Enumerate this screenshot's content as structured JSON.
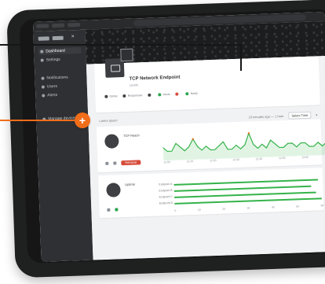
{
  "sidebar": {
    "close_glyph": "×",
    "sections": [
      {
        "title": "",
        "items": [
          {
            "label": "Dashboard",
            "active": true
          },
          {
            "label": "Settings",
            "active": false
          }
        ]
      },
      {
        "title": "",
        "items": [
          {
            "label": "Notifications",
            "active": false
          },
          {
            "label": "Users",
            "active": false
          },
          {
            "label": "Alerts",
            "active": false
          }
        ]
      },
      {
        "title": "",
        "items": [
          {
            "label": "Manage devices",
            "active": false
          }
        ]
      }
    ]
  },
  "header": {
    "title": "TCP Network Endpoint",
    "subtitle": "Lorem"
  },
  "actions": [
    {
      "label": "Online",
      "color": "#444444"
    },
    {
      "label": "Responsive",
      "color": "#444444"
    },
    {
      "label": "",
      "color": "#444444"
    },
    {
      "label": "Alerts",
      "color": "#2ea44f"
    },
    {
      "label": "",
      "color": "#d64b3a"
    },
    {
      "label": "Notify",
      "color": "#2ea44f"
    }
  ],
  "filter": {
    "left": "Lorem ipsum",
    "range": "10 minutes ago — 1 hour",
    "select": "Select Time"
  },
  "metrics": [
    {
      "title": "TCP Reach",
      "button": "Remove",
      "x_ticks": [
        "12:00",
        "12:10",
        "12:20",
        "12:30",
        "12:40",
        "12:50",
        "13:00",
        "13:10"
      ],
      "chart_points": [
        3,
        2,
        2,
        4,
        3,
        2,
        3,
        5,
        3,
        2,
        3,
        2,
        2,
        3,
        4,
        2,
        2,
        3,
        2,
        3,
        6,
        3,
        2,
        3,
        2,
        4,
        3,
        2,
        2,
        3,
        3,
        2,
        3,
        3,
        2,
        2,
        3,
        2,
        3,
        2
      ]
    },
    {
      "title": "Uptime",
      "bars": [
        {
          "label": "Endpoint A",
          "value": 0.97
        },
        {
          "label": "Endpoint B",
          "value": 0.92
        },
        {
          "label": "Endpoint C",
          "value": 0.95
        },
        {
          "label": "Endpoint D",
          "value": 0.99
        }
      ],
      "x_ticks": [
        "0",
        "10",
        "20",
        "30",
        "40",
        "50",
        "60"
      ]
    }
  ],
  "overlay": {
    "plus_label": "+",
    "accent": "#f06d1a"
  }
}
